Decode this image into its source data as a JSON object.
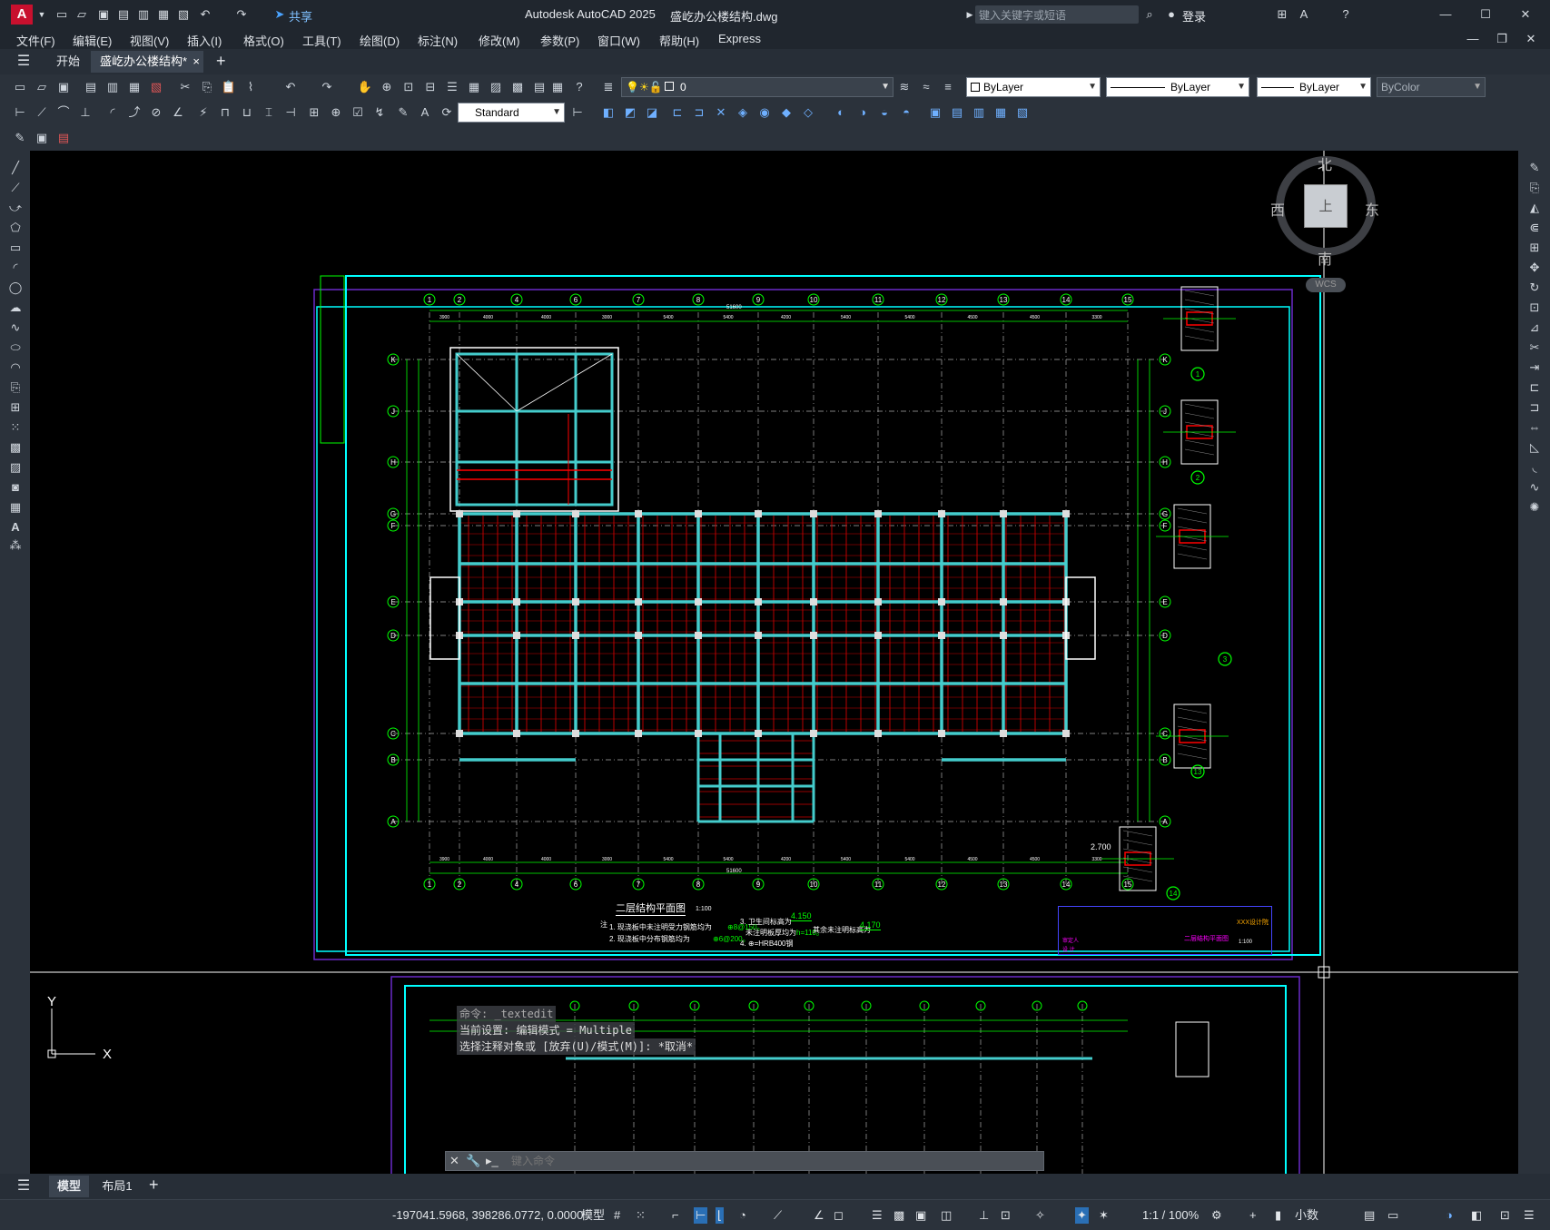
{
  "titlebar": {
    "app_title": "Autodesk AutoCAD 2025",
    "file_name": "盛屹办公楼结构.dwg",
    "search_placeholder": "键入关键字或短语",
    "login": "登录",
    "share": "共享"
  },
  "menubar": {
    "items": [
      "文件(F)",
      "编辑(E)",
      "视图(V)",
      "插入(I)",
      "格式(O)",
      "工具(T)",
      "绘图(D)",
      "标注(N)",
      "修改(M)",
      "参数(P)",
      "窗口(W)",
      "帮助(H)",
      "Express"
    ]
  },
  "tabs": {
    "start": "开始",
    "doc": "盛屹办公楼结构*",
    "close": "×",
    "add": "+"
  },
  "toolbar": {
    "layer": "0",
    "color": "ByLayer",
    "linetype": "ByLayer",
    "lineweight": "ByLayer",
    "plotstyle": "ByColor",
    "textstyle": "Standard"
  },
  "viewcube": {
    "north": "北",
    "south": "南",
    "east": "东",
    "west": "西",
    "face": "上",
    "wcs": "WCS"
  },
  "drawing": {
    "title": "二层结构平面图",
    "scale": "1:100",
    "grid_x": [
      "1",
      "2",
      "4",
      "6",
      "7",
      "8",
      "9",
      "10",
      "11",
      "12",
      "13",
      "14",
      "15"
    ],
    "grid_y": [
      "K",
      "J",
      "H",
      "G",
      "F",
      "E",
      "D",
      "C",
      "B",
      "A"
    ],
    "dims_top": [
      "3900",
      "4000",
      "4000",
      "3000",
      "5400",
      "5400",
      "4200",
      "5400",
      "5400",
      "4500",
      "4500",
      "3300"
    ],
    "total_dim": "51600",
    "section_labels": [
      "1",
      "2",
      "3",
      "13",
      "14"
    ],
    "note_head": "注",
    "notes": [
      "1. 现浇板中未注明受力钢筋均为",
      "2. 现浇板中分布钢筋均为",
      "3. 卫生间标高为",
      "未注明板厚均为",
      "4. ⊕=HRB400钢"
    ],
    "note_values": [
      "⊕8@150。",
      "⊕6@200。",
      "4.150",
      "h=110。",
      "4.170"
    ],
    "note_extra": "其余未注明标高为",
    "elevations": [
      "2.700"
    ],
    "titleblock": {
      "project": "二层结构平面图",
      "scale": "1:100",
      "title_left": [
        "审定人",
        "设 计"
      ],
      "company": "XXX设计院"
    }
  },
  "command": {
    "line1": "命令: _textedit",
    "line2": "当前设置: 编辑模式 = Multiple",
    "line3": "选择注释对象或 [放弃(U)/模式(M)]: *取消*",
    "placeholder": "键入命令"
  },
  "layouts": {
    "model": "模型",
    "layout1": "布局1",
    "add": "+"
  },
  "status": {
    "coords": "-197041.5968, 398286.0772, 0.0000",
    "space": "模型",
    "scale": "1:1 / 100%",
    "units": "小数"
  }
}
